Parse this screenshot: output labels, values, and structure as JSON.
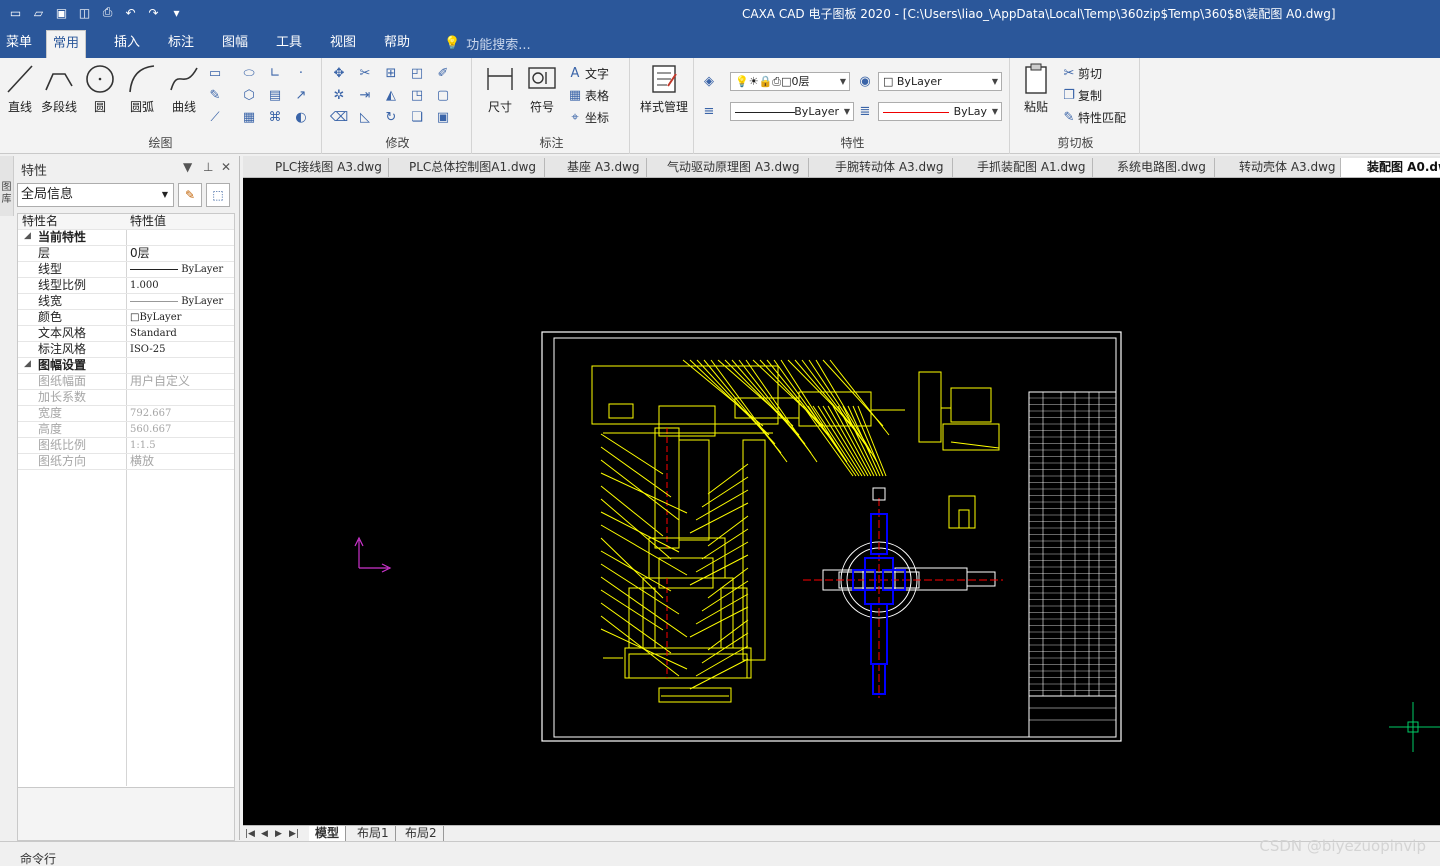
{
  "window": {
    "title": "CAXA CAD 电子图板 2020 - [C:\\Users\\liao_\\AppData\\Local\\Temp\\360zip$Temp\\360$8\\装配图 A0.dwg]"
  },
  "quick_access": [
    "new-icon",
    "open-icon",
    "save-icon",
    "save-all-icon",
    "print-icon",
    "undo-icon",
    "redo-icon",
    "customize-icon"
  ],
  "menu": {
    "tabs": [
      "菜单",
      "常用",
      "插入",
      "标注",
      "图幅",
      "工具",
      "视图",
      "帮助"
    ],
    "active": "常用",
    "search_placeholder": "功能搜索..."
  },
  "ribbon": {
    "draw": {
      "label": "绘图",
      "buttons": [
        "直线",
        "多段线",
        "圆",
        "圆弧",
        "曲线"
      ]
    },
    "modify": {
      "label": "修改"
    },
    "annotate": {
      "label": "标注",
      "buttons": [
        "尺寸",
        "符号"
      ],
      "text": "文字",
      "table": "表格",
      "coord": "坐标"
    },
    "style": {
      "label": "样式管理"
    },
    "properties": {
      "label": "特性",
      "layer": "0层",
      "color": "ByLayer",
      "linetype": "ByLayer",
      "linewidth": "ByLay\u0000"
    },
    "clipboard": {
      "label": "剪切板",
      "paste": "粘贴",
      "cut": "剪切",
      "copy": "复制",
      "match": "特性匹配"
    }
  },
  "panel": {
    "title": "特性",
    "side_tab": "图库",
    "scope": "全局信息",
    "col_name": "特性名",
    "col_value": "特性值",
    "current": {
      "label": "当前特性",
      "rows": [
        {
          "name": "层",
          "value": "0层"
        },
        {
          "name": "线型",
          "value": "ByLayer"
        },
        {
          "name": "线型比例",
          "value": "1.000"
        },
        {
          "name": "线宽",
          "value": "ByLayer"
        },
        {
          "name": "颜色",
          "value": "ByLayer"
        },
        {
          "name": "文本风格",
          "value": "Standard"
        },
        {
          "name": "标注风格",
          "value": "ISO-25"
        }
      ]
    },
    "sheet": {
      "label": "图幅设置",
      "rows": [
        {
          "name": "图纸幅面",
          "value": "用户自定义"
        },
        {
          "name": "加长系数",
          "value": ""
        },
        {
          "name": "宽度",
          "value": "792.667"
        },
        {
          "name": "高度",
          "value": "560.667"
        },
        {
          "name": "图纸比例",
          "value": "1:1.5"
        },
        {
          "name": "图纸方向",
          "value": "横放"
        }
      ]
    }
  },
  "doc_tabs": [
    "PLC接线图 A3.dwg",
    "PLC总体控制图A1.dwg",
    "基座 A3.dwg",
    "气动驱动原理图 A3.dwg",
    "手腕转动体 A3.dwg",
    "手抓装配图 A1.dwg",
    "系统电路图.dwg",
    "转动壳体 A3.dwg",
    "装配图 A0.dwg"
  ],
  "active_doc": "装配图 A0.dwg",
  "layout_tabs": [
    "模型",
    "布局1",
    "布局2"
  ],
  "active_layout": "模型",
  "command": {
    "label": "命令行"
  },
  "watermark": "CSDN @biyezuopinvip",
  "colors": {
    "title_bar": "#2b579a",
    "canvas": "#000000",
    "drawing_yellow": "#ffff00",
    "drawing_blue": "#0000ff",
    "drawing_red": "#ff0000",
    "drawing_white": "#ffffff",
    "ucs_magenta": "#cc33cc",
    "cursor_cyan": "#00cc66"
  }
}
